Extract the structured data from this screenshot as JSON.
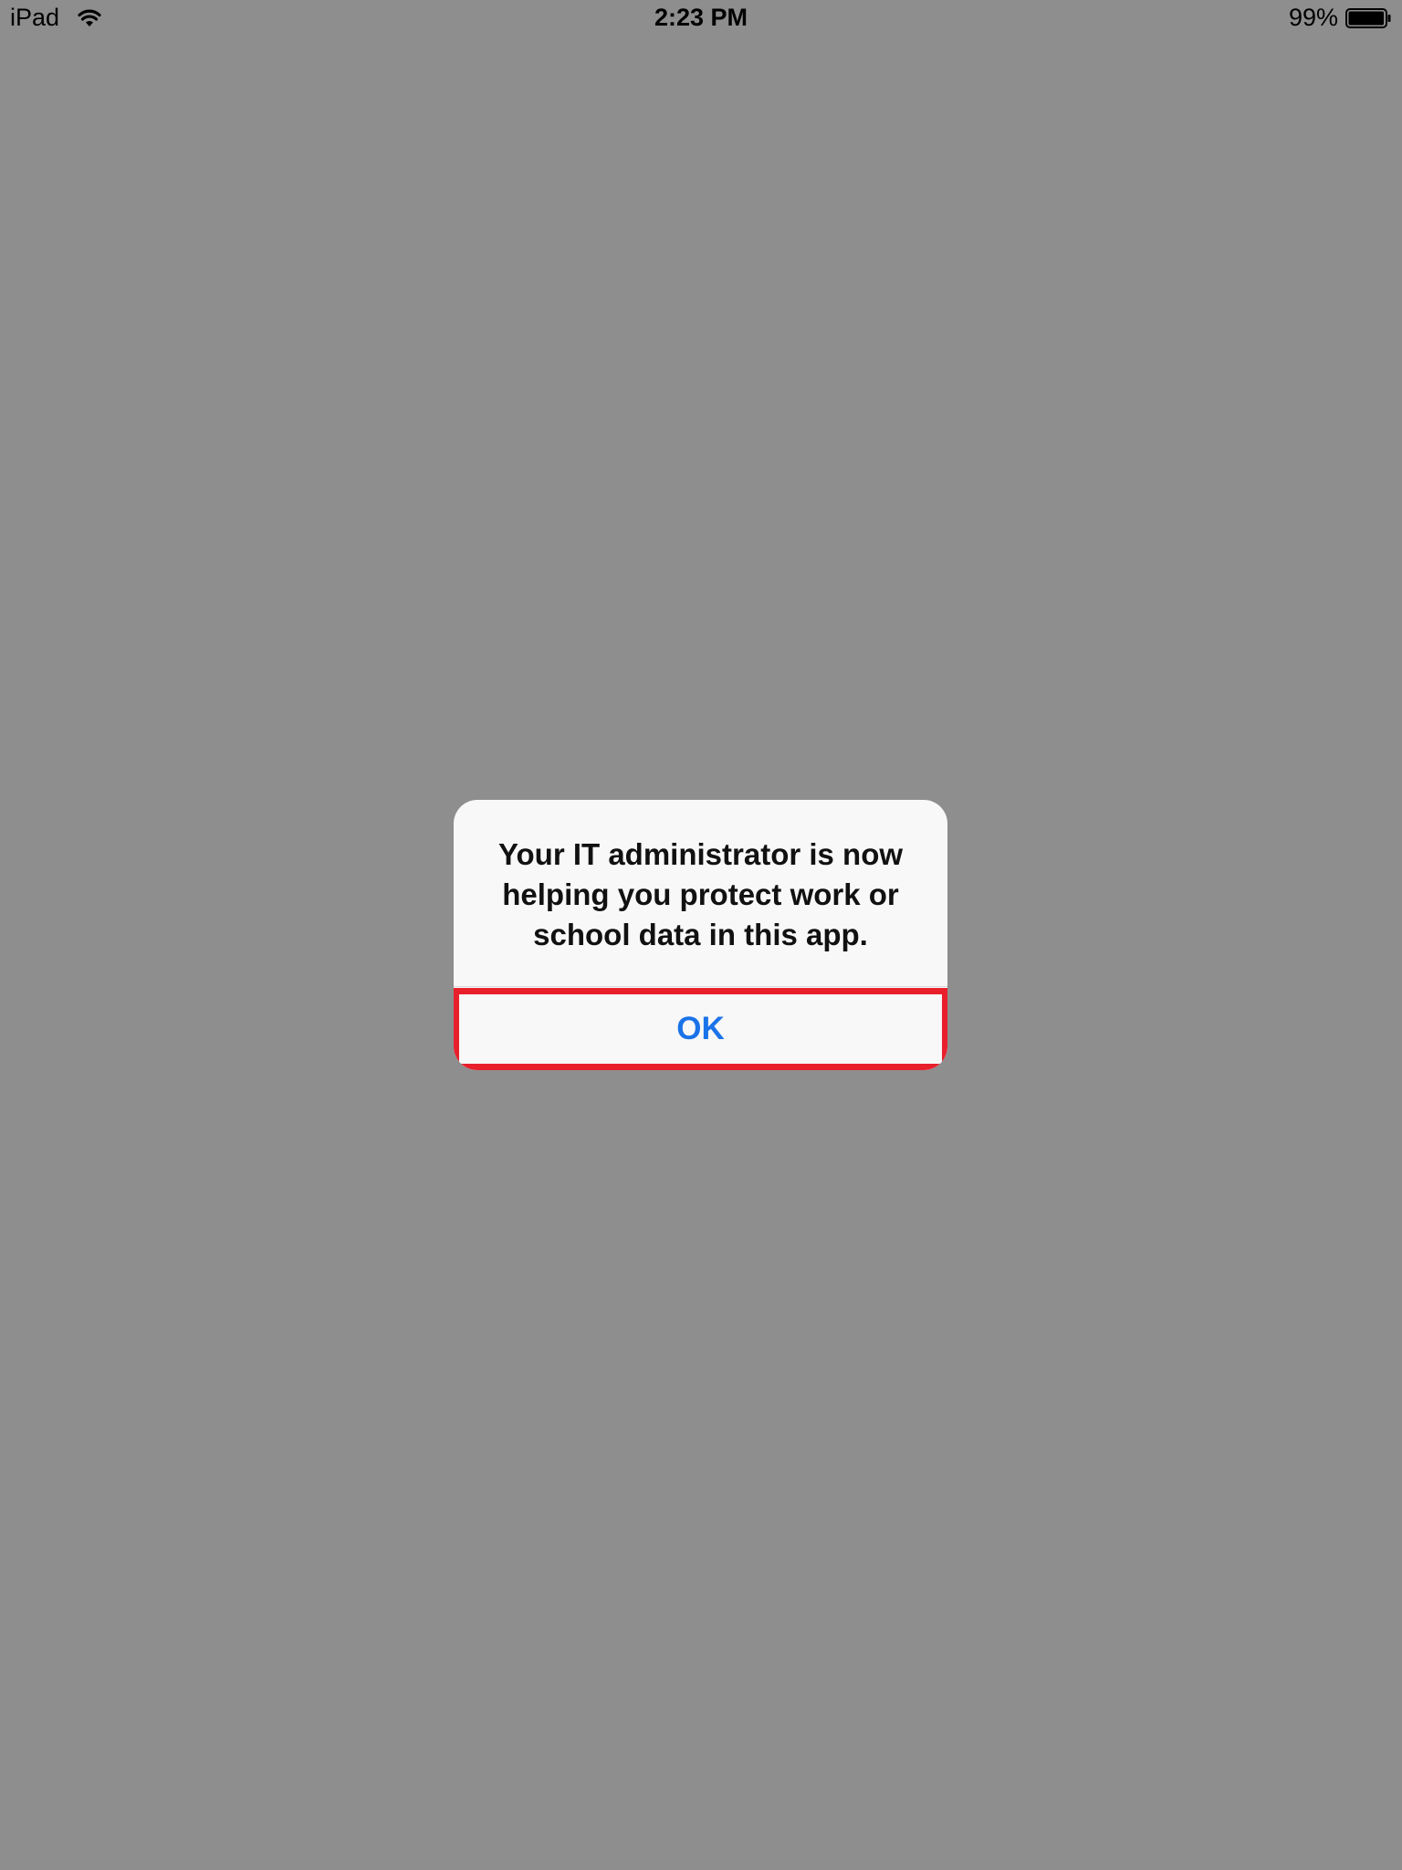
{
  "status_bar": {
    "device": "iPad",
    "time": "2:23 PM",
    "battery": "99%",
    "battery_level": 0.99,
    "icons": [
      "wifi-icon",
      "battery-icon"
    ]
  },
  "alert": {
    "message": "Your IT administrator is now helping you protect work or school data in this app.",
    "ok_label": "OK"
  },
  "colors": {
    "overlay": "#8e8e8e",
    "alert_bg": "#f8f8f8",
    "button_text": "#1a73e8",
    "highlight_border": "#e8202c"
  }
}
